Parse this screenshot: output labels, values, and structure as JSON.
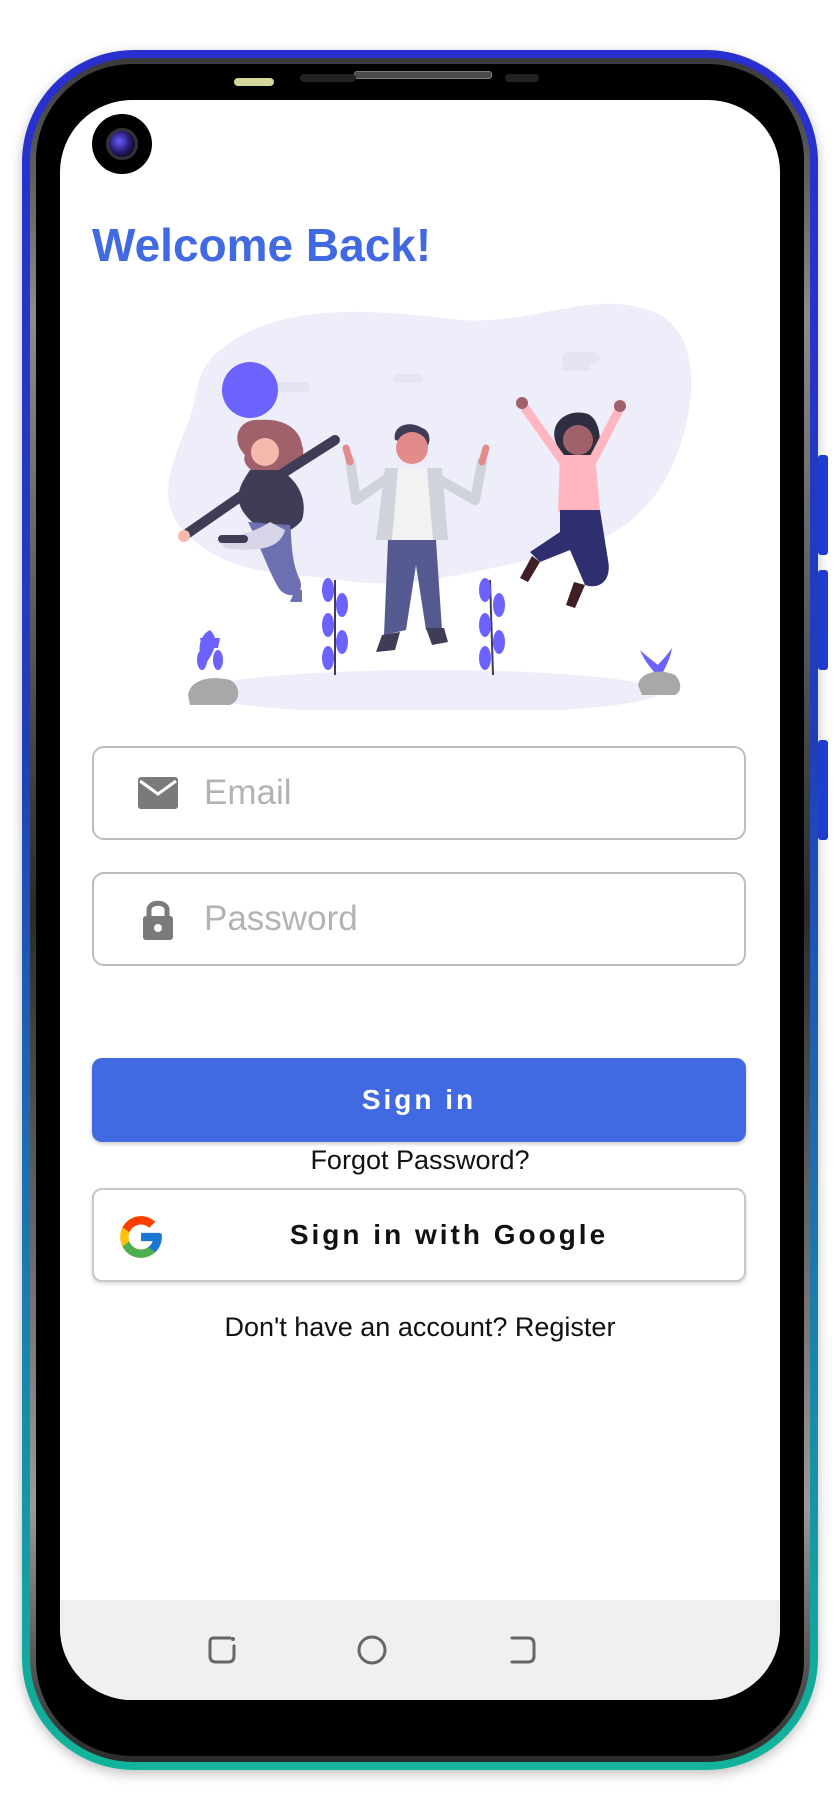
{
  "screen": {
    "title": "Welcome Back!",
    "email": {
      "placeholder": "Email",
      "value": "",
      "icon": "mail-icon"
    },
    "password": {
      "placeholder": "Password",
      "value": "",
      "icon": "lock-icon"
    },
    "sign_in_label": "Sign in",
    "google_label": "Sign in with Google",
    "forgot_label": "Forgot Password?",
    "register_label": "Don't have an account? Register"
  },
  "colors": {
    "accent": "#4169e1",
    "illustration_accent": "#6c63ff",
    "nav_bar": "#f0f0f0"
  },
  "nav": {
    "back_icon": "back-icon",
    "home_icon": "home-icon",
    "recents_icon": "recents-icon"
  }
}
